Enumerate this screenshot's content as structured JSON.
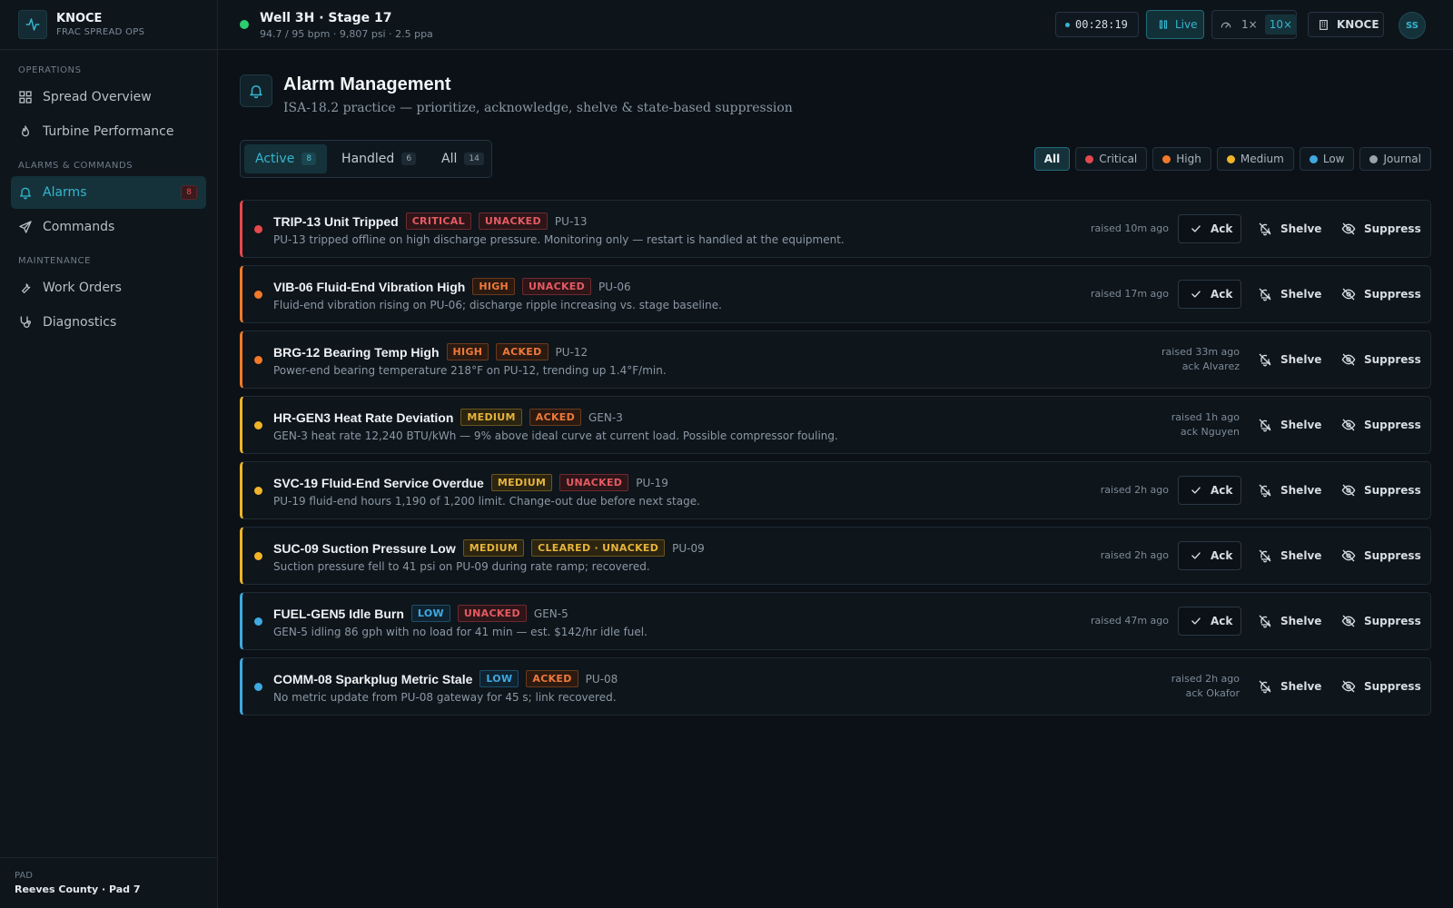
{
  "app": {
    "name": "KNOCE",
    "subtitle": "FRAC SPREAD OPS"
  },
  "sidebar": {
    "sections": [
      {
        "label": "OPERATIONS",
        "items": [
          {
            "label": "Spread Overview",
            "icon": "grid-icon"
          },
          {
            "label": "Turbine Performance",
            "icon": "flame-icon"
          }
        ]
      },
      {
        "label": "ALARMS & COMMANDS",
        "items": [
          {
            "label": "Alarms",
            "icon": "bell-icon",
            "badge": "8",
            "active": true
          },
          {
            "label": "Commands",
            "icon": "send-icon"
          }
        ]
      },
      {
        "label": "MAINTENANCE",
        "items": [
          {
            "label": "Work Orders",
            "icon": "wrench-icon"
          },
          {
            "label": "Diagnostics",
            "icon": "stethoscope-icon"
          }
        ]
      }
    ],
    "pad": {
      "label": "PAD",
      "value": "Reeves County · Pad 7"
    }
  },
  "topbar": {
    "title": "Well 3H · Stage 17",
    "subtitle": "94.7 / 95 bpm · 9,807 psi · 2.5 ppa",
    "timer": "00:28:19",
    "live_label": "Live",
    "speed_1x": "1×",
    "speed_10x": "10×",
    "org": "KNOCE",
    "user_initials": "SS"
  },
  "page": {
    "title": "Alarm Management",
    "subtitle": "ISA-18.2 practice — prioritize, acknowledge, shelve & state-based suppression"
  },
  "tabs": [
    {
      "label": "Active",
      "count": "8",
      "active": true
    },
    {
      "label": "Handled",
      "count": "6"
    },
    {
      "label": "All",
      "count": "14"
    }
  ],
  "filters": [
    {
      "label": "All",
      "active": true
    },
    {
      "label": "Critical",
      "color": "#e5484d"
    },
    {
      "label": "High",
      "color": "#f07a2a"
    },
    {
      "label": "Medium",
      "color": "#f0b429"
    },
    {
      "label": "Low",
      "color": "#3fa9e0"
    },
    {
      "label": "Journal",
      "color": "#9aa3ab"
    }
  ],
  "actions": {
    "ack": "Ack",
    "shelve": "Shelve",
    "suppress": "Suppress"
  },
  "alarms": [
    {
      "title": "TRIP-13 Unit Tripped",
      "severity": "CRITICAL",
      "state": "UNACKED",
      "unit": "PU-13",
      "desc": "PU-13 tripped offline on high discharge pressure. Monitoring only — restart is handled at the equipment.",
      "raised": "raised 10m ago",
      "ack_by": "",
      "can_ack": true
    },
    {
      "title": "VIB-06 Fluid-End Vibration High",
      "severity": "HIGH",
      "state": "UNACKED",
      "unit": "PU-06",
      "desc": "Fluid-end vibration rising on PU-06; discharge ripple increasing vs. stage baseline.",
      "raised": "raised 17m ago",
      "ack_by": "",
      "can_ack": true
    },
    {
      "title": "BRG-12 Bearing Temp High",
      "severity": "HIGH",
      "state": "ACKED",
      "unit": "PU-12",
      "desc": "Power-end bearing temperature 218°F on PU-12, trending up 1.4°F/min.",
      "raised": "raised 33m ago",
      "ack_by": "ack Alvarez",
      "can_ack": false
    },
    {
      "title": "HR-GEN3 Heat Rate Deviation",
      "severity": "MEDIUM",
      "state": "ACKED",
      "unit": "GEN-3",
      "desc": "GEN-3 heat rate 12,240 BTU/kWh — 9% above ideal curve at current load. Possible compressor fouling.",
      "raised": "raised 1h ago",
      "ack_by": "ack Nguyen",
      "can_ack": false
    },
    {
      "title": "SVC-19 Fluid-End Service Overdue",
      "severity": "MEDIUM",
      "state": "UNACKED",
      "unit": "PU-19",
      "desc": "PU-19 fluid-end hours 1,190 of 1,200 limit. Change-out due before next stage.",
      "raised": "raised 2h ago",
      "ack_by": "",
      "can_ack": true
    },
    {
      "title": "SUC-09 Suction Pressure Low",
      "severity": "MEDIUM",
      "state": "CLEARED · UNACKED",
      "unit": "PU-09",
      "desc": "Suction pressure fell to 41 psi on PU-09 during rate ramp; recovered.",
      "raised": "raised 2h ago",
      "ack_by": "",
      "can_ack": true
    },
    {
      "title": "FUEL-GEN5 Idle Burn",
      "severity": "LOW",
      "state": "UNACKED",
      "unit": "GEN-5",
      "desc": "GEN-5 idling 86 gph with no load for 41 min — est. $142/hr idle fuel.",
      "raised": "raised 47m ago",
      "ack_by": "",
      "can_ack": true
    },
    {
      "title": "COMM-08 Sparkplug Metric Stale",
      "severity": "LOW",
      "state": "ACKED",
      "unit": "PU-08",
      "desc": "No metric update from PU-08 gateway for 45 s; link recovered.",
      "raised": "raised 2h ago",
      "ack_by": "ack Okafor",
      "can_ack": false
    }
  ],
  "colors": {
    "accent": "#35b6cf",
    "critical": "#e5484d",
    "high": "#f07a2a",
    "medium": "#f0b429",
    "low": "#3fa9e0",
    "live": "#2ecc71"
  }
}
